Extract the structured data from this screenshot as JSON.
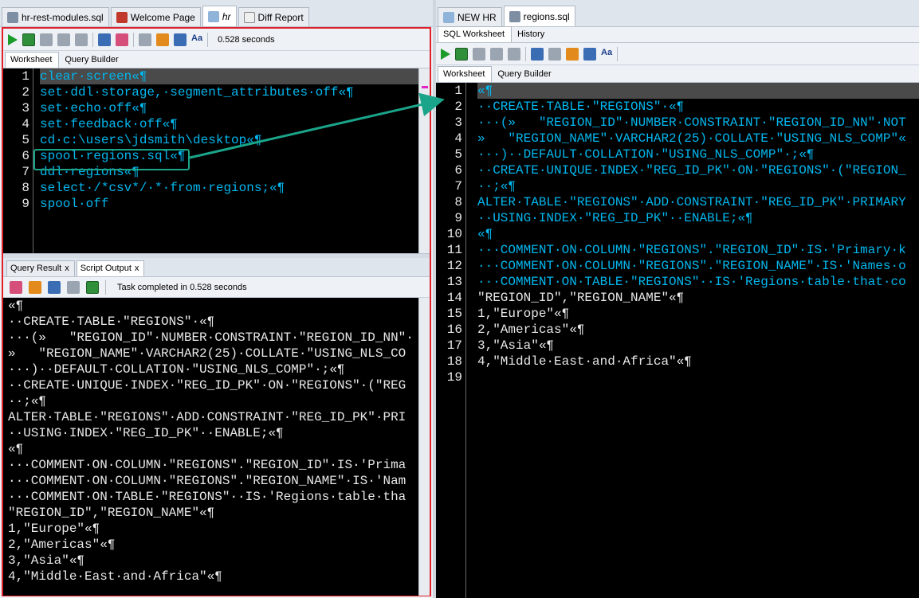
{
  "left": {
    "tabs": [
      {
        "label": "hr-rest-modules.sql",
        "icon": "sql-file-icon",
        "active": false
      },
      {
        "label": "Welcome Page",
        "icon": "welcome-icon",
        "active": false
      },
      {
        "label": "hr",
        "icon": "sql-connection-icon",
        "active": true
      },
      {
        "label": "Diff Report",
        "icon": "diff-report-icon",
        "active": false
      }
    ],
    "elapsed": "0.528 seconds",
    "subtabs": [
      "Worksheet",
      "Query Builder"
    ],
    "editor_lines": [
      {
        "n": "1",
        "text": "clear·screen«¶"
      },
      {
        "n": "2",
        "text": "set·ddl·storage,·segment_attributes·off«¶"
      },
      {
        "n": "3",
        "text": "set·echo·off«¶"
      },
      {
        "n": "4",
        "text": "set·feedback·off«¶"
      },
      {
        "n": "5",
        "text": "cd·c:\\users\\jdsmith\\desktop«¶"
      },
      {
        "n": "6",
        "text": "spool·regions.sql«¶"
      },
      {
        "n": "7",
        "text": "ddl·regions«¶"
      },
      {
        "n": "8",
        "text": "select·/*csv*/·*·from·regions;«¶"
      },
      {
        "n": "9",
        "text": "spool·off"
      }
    ],
    "output_tabs": [
      {
        "label": "Query Result",
        "close": "x"
      },
      {
        "label": "Script Output",
        "close": "x"
      }
    ],
    "task_status": "Task completed in 0.528 seconds",
    "output_lines": [
      "«¶",
      "··CREATE·TABLE·\"REGIONS\"·«¶",
      "···(»   \"REGION_ID\"·NUMBER·CONSTRAINT·\"REGION_ID_NN\"·",
      "»   \"REGION_NAME\"·VARCHAR2(25)·COLLATE·\"USING_NLS_CO",
      "···)··DEFAULT·COLLATION·\"USING_NLS_COMP\"·;«¶",
      "··CREATE·UNIQUE·INDEX·\"REG_ID_PK\"·ON·\"REGIONS\"·(\"REG",
      "··;«¶",
      "ALTER·TABLE·\"REGIONS\"·ADD·CONSTRAINT·\"REG_ID_PK\"·PRI",
      "··USING·INDEX·\"REG_ID_PK\"··ENABLE;«¶",
      "«¶",
      "···COMMENT·ON·COLUMN·\"REGIONS\".\"REGION_ID\"·IS·'Prima",
      "···COMMENT·ON·COLUMN·\"REGIONS\".\"REGION_NAME\"·IS·'Nam",
      "···COMMENT·ON·TABLE·\"REGIONS\"··IS·'Regions·table·tha",
      "\"REGION_ID\",\"REGION_NAME\"«¶",
      "1,\"Europe\"«¶",
      "2,\"Americas\"«¶",
      "3,\"Asia\"«¶",
      "4,\"Middle·East·and·Africa\"«¶"
    ]
  },
  "right": {
    "tabs": [
      {
        "label": "NEW HR",
        "icon": "connection-icon",
        "active": false
      },
      {
        "label": "regions.sql",
        "icon": "sql-file-icon",
        "active": true
      }
    ],
    "view_tabs": [
      "SQL Worksheet",
      "History"
    ],
    "subtabs": [
      "Worksheet",
      "Query Builder"
    ],
    "editor_lines": [
      {
        "n": "1",
        "text": "«¶"
      },
      {
        "n": "2",
        "text": "··CREATE·TABLE·\"REGIONS\"·«¶"
      },
      {
        "n": "3",
        "text": "···(»   \"REGION_ID\"·NUMBER·CONSTRAINT·\"REGION_ID_NN\"·NOT"
      },
      {
        "n": "4",
        "text": "»   \"REGION_NAME\"·VARCHAR2(25)·COLLATE·\"USING_NLS_COMP\"«"
      },
      {
        "n": "5",
        "text": "···)··DEFAULT·COLLATION·\"USING_NLS_COMP\"·;«¶"
      },
      {
        "n": "6",
        "text": "··CREATE·UNIQUE·INDEX·\"REG_ID_PK\"·ON·\"REGIONS\"·(\"REGION_"
      },
      {
        "n": "7",
        "text": "··;«¶"
      },
      {
        "n": "8",
        "text": "ALTER·TABLE·\"REGIONS\"·ADD·CONSTRAINT·\"REG_ID_PK\"·PRIMARY"
      },
      {
        "n": "9",
        "text": "··USING·INDEX·\"REG_ID_PK\"··ENABLE;«¶"
      },
      {
        "n": "10",
        "text": "«¶"
      },
      {
        "n": "11",
        "text": "···COMMENT·ON·COLUMN·\"REGIONS\".\"REGION_ID\"·IS·'Primary·k"
      },
      {
        "n": "12",
        "text": "···COMMENT·ON·COLUMN·\"REGIONS\".\"REGION_NAME\"·IS·'Names·o"
      },
      {
        "n": "13",
        "text": "···COMMENT·ON·TABLE·\"REGIONS\"··IS·'Regions·table·that·co"
      },
      {
        "n": "14",
        "text": "\"REGION_ID\",\"REGION_NAME\"«¶"
      },
      {
        "n": "15",
        "text": "1,\"Europe\"«¶"
      },
      {
        "n": "16",
        "text": "2,\"Americas\"«¶"
      },
      {
        "n": "17",
        "text": "3,\"Asia\"«¶"
      },
      {
        "n": "18",
        "text": "4,\"Middle·East·and·Africa\"«¶"
      },
      {
        "n": "19",
        "text": ""
      }
    ]
  },
  "colors": {
    "highlight_frame": "#e0202a",
    "callout": "#1aa58a",
    "keyword": "#00b7ee",
    "editor_bg": "#000000"
  }
}
